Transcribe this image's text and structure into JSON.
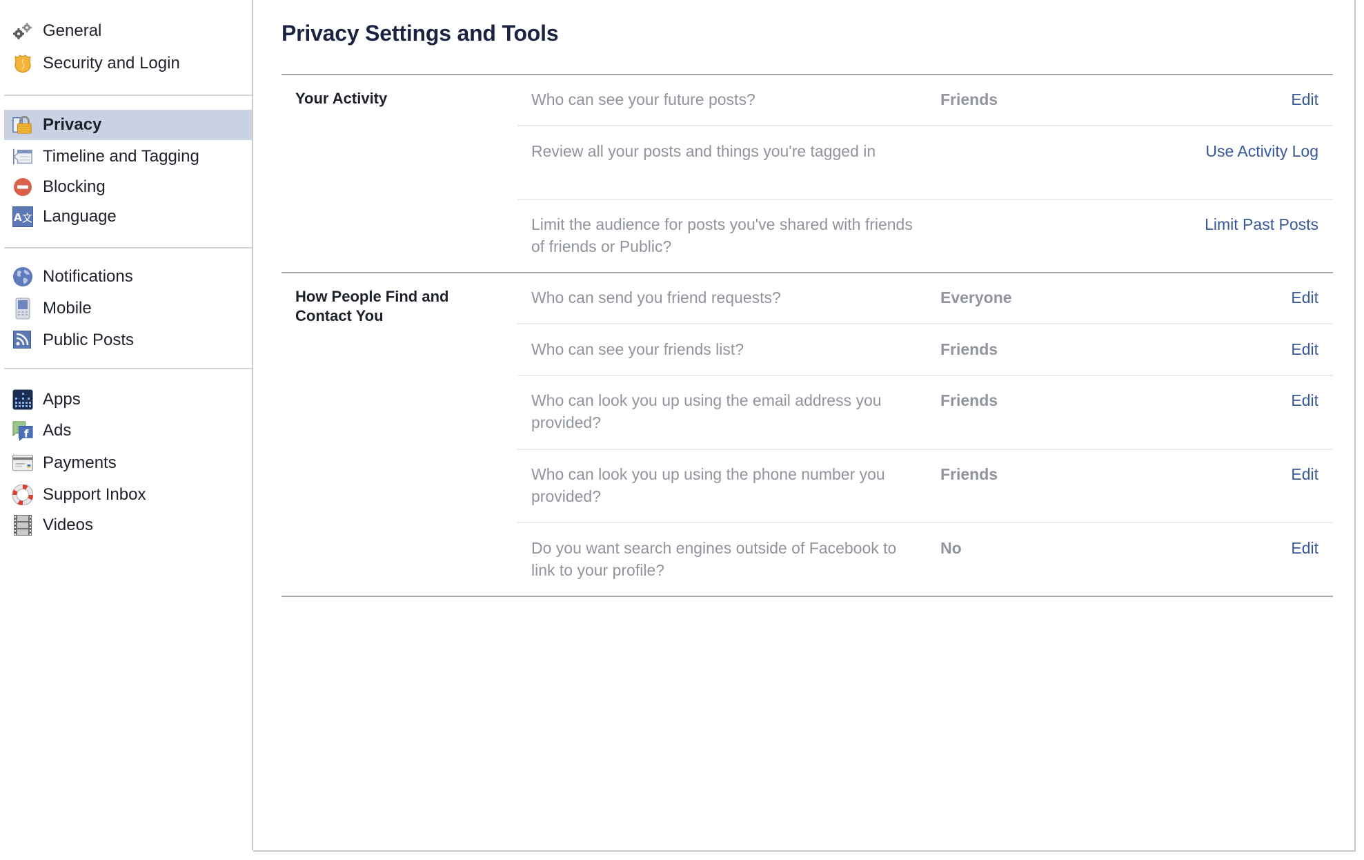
{
  "sidebar": {
    "groups": [
      [
        {
          "label": "General",
          "icon": "gears-icon"
        },
        {
          "label": "Security and Login",
          "icon": "shield-badge-icon"
        }
      ],
      [
        {
          "label": "Privacy",
          "icon": "padlock-icon",
          "active": true
        },
        {
          "label": "Timeline and Tagging",
          "icon": "timeline-icon"
        },
        {
          "label": "Blocking",
          "icon": "blocking-icon"
        },
        {
          "label": "Language",
          "icon": "language-icon"
        }
      ],
      [
        {
          "label": "Notifications",
          "icon": "globe-icon"
        },
        {
          "label": "Mobile",
          "icon": "mobile-phone-icon"
        },
        {
          "label": "Public Posts",
          "icon": "rss-icon"
        }
      ],
      [
        {
          "label": "Apps",
          "icon": "apps-icon"
        },
        {
          "label": "Ads",
          "icon": "ads-icon"
        },
        {
          "label": "Payments",
          "icon": "credit-card-icon"
        },
        {
          "label": "Support Inbox",
          "icon": "lifebuoy-icon"
        },
        {
          "label": "Videos",
          "icon": "film-strip-icon"
        }
      ]
    ]
  },
  "main": {
    "title": "Privacy Settings and Tools",
    "sections": [
      {
        "label": "Your Activity",
        "rows": [
          {
            "question": "Who can see your future posts?",
            "value": "Friends",
            "action": "Edit"
          },
          {
            "question": "Review all your posts and things you're tagged in",
            "value": "",
            "action": "Use Activity Log"
          },
          {
            "question": "Limit the audience for posts you've shared with friends of friends or Public?",
            "value": "",
            "action": "Limit Past Posts"
          }
        ]
      },
      {
        "label": "How People Find and Contact You",
        "rows": [
          {
            "question": "Who can send you friend requests?",
            "value": "Everyone",
            "action": "Edit"
          },
          {
            "question": "Who can see your friends list?",
            "value": "Friends",
            "action": "Edit"
          },
          {
            "question": "Who can look you up using the email address you provided?",
            "value": "Friends",
            "action": "Edit"
          },
          {
            "question": "Who can look you up using the phone number you provided?",
            "value": "Friends",
            "action": "Edit"
          },
          {
            "question": "Do you want search engines outside of Facebook to link to your profile?",
            "value": "No",
            "action": "Edit"
          }
        ]
      }
    ]
  },
  "colors": {
    "link": "#365899",
    "muted_text": "#90949c",
    "title": "#1c2340",
    "active_nav_bg": "#c9d2e3"
  }
}
